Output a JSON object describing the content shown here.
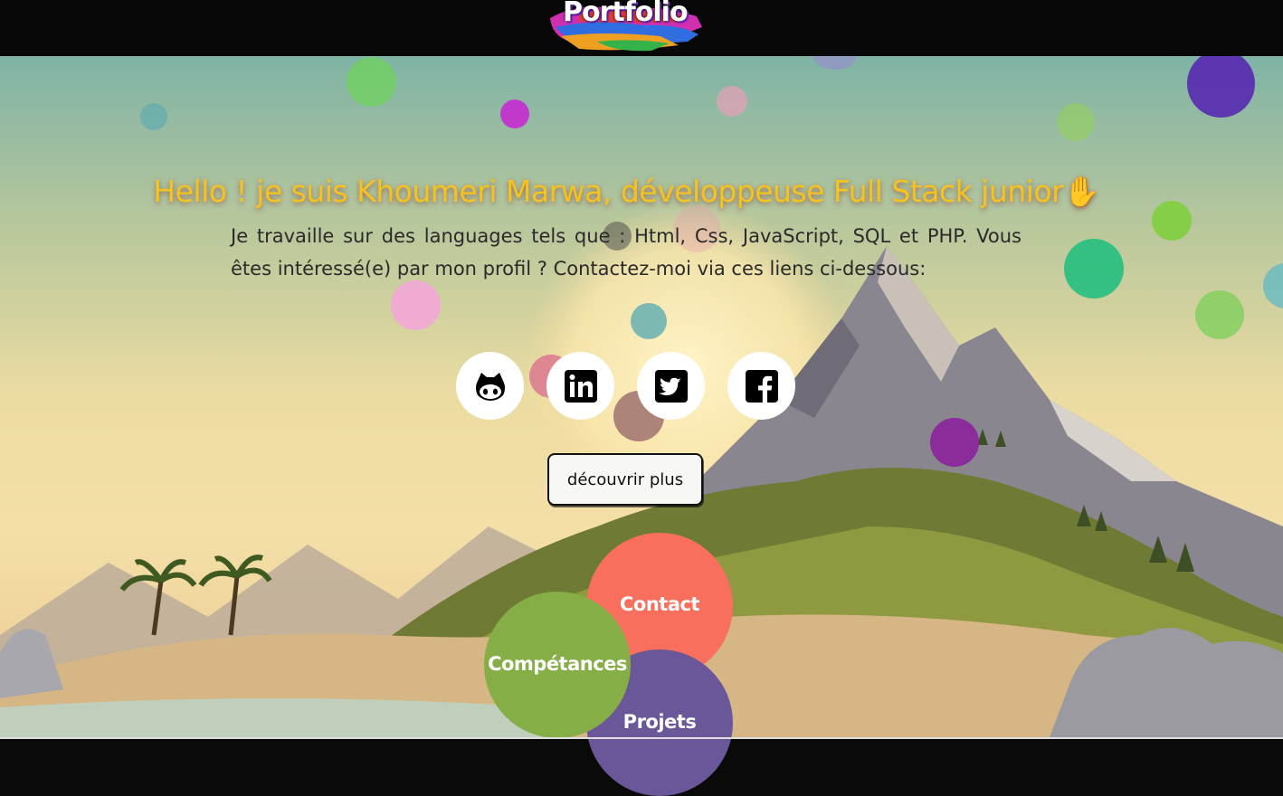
{
  "header": {
    "logo_text": "Portfolio"
  },
  "hero": {
    "headline": "Hello ! je suis Khoumeri Marwa, développeuse Full Stack junior",
    "wave_emoji": "✋",
    "intro": "Je travaille sur des languages tels que : Html, Css, JavaScript, SQL et PHP. Vous êtes intéressé(e) par mon profil ? Contactez-moi via ces liens ci-dessous:"
  },
  "socials": [
    {
      "icon": "github-icon"
    },
    {
      "icon": "linkedin-icon"
    },
    {
      "icon": "twitter-icon"
    },
    {
      "icon": "facebook-icon"
    }
  ],
  "cta": {
    "discover_label": "découvrir plus"
  },
  "menu": {
    "contact": "Contact",
    "competences": "Compétances",
    "projets": "Projets"
  },
  "colors": {
    "headline": "#f6c21f",
    "contact": "#f96f5d",
    "competences": "#86ae46",
    "projets": "#6a5799"
  }
}
